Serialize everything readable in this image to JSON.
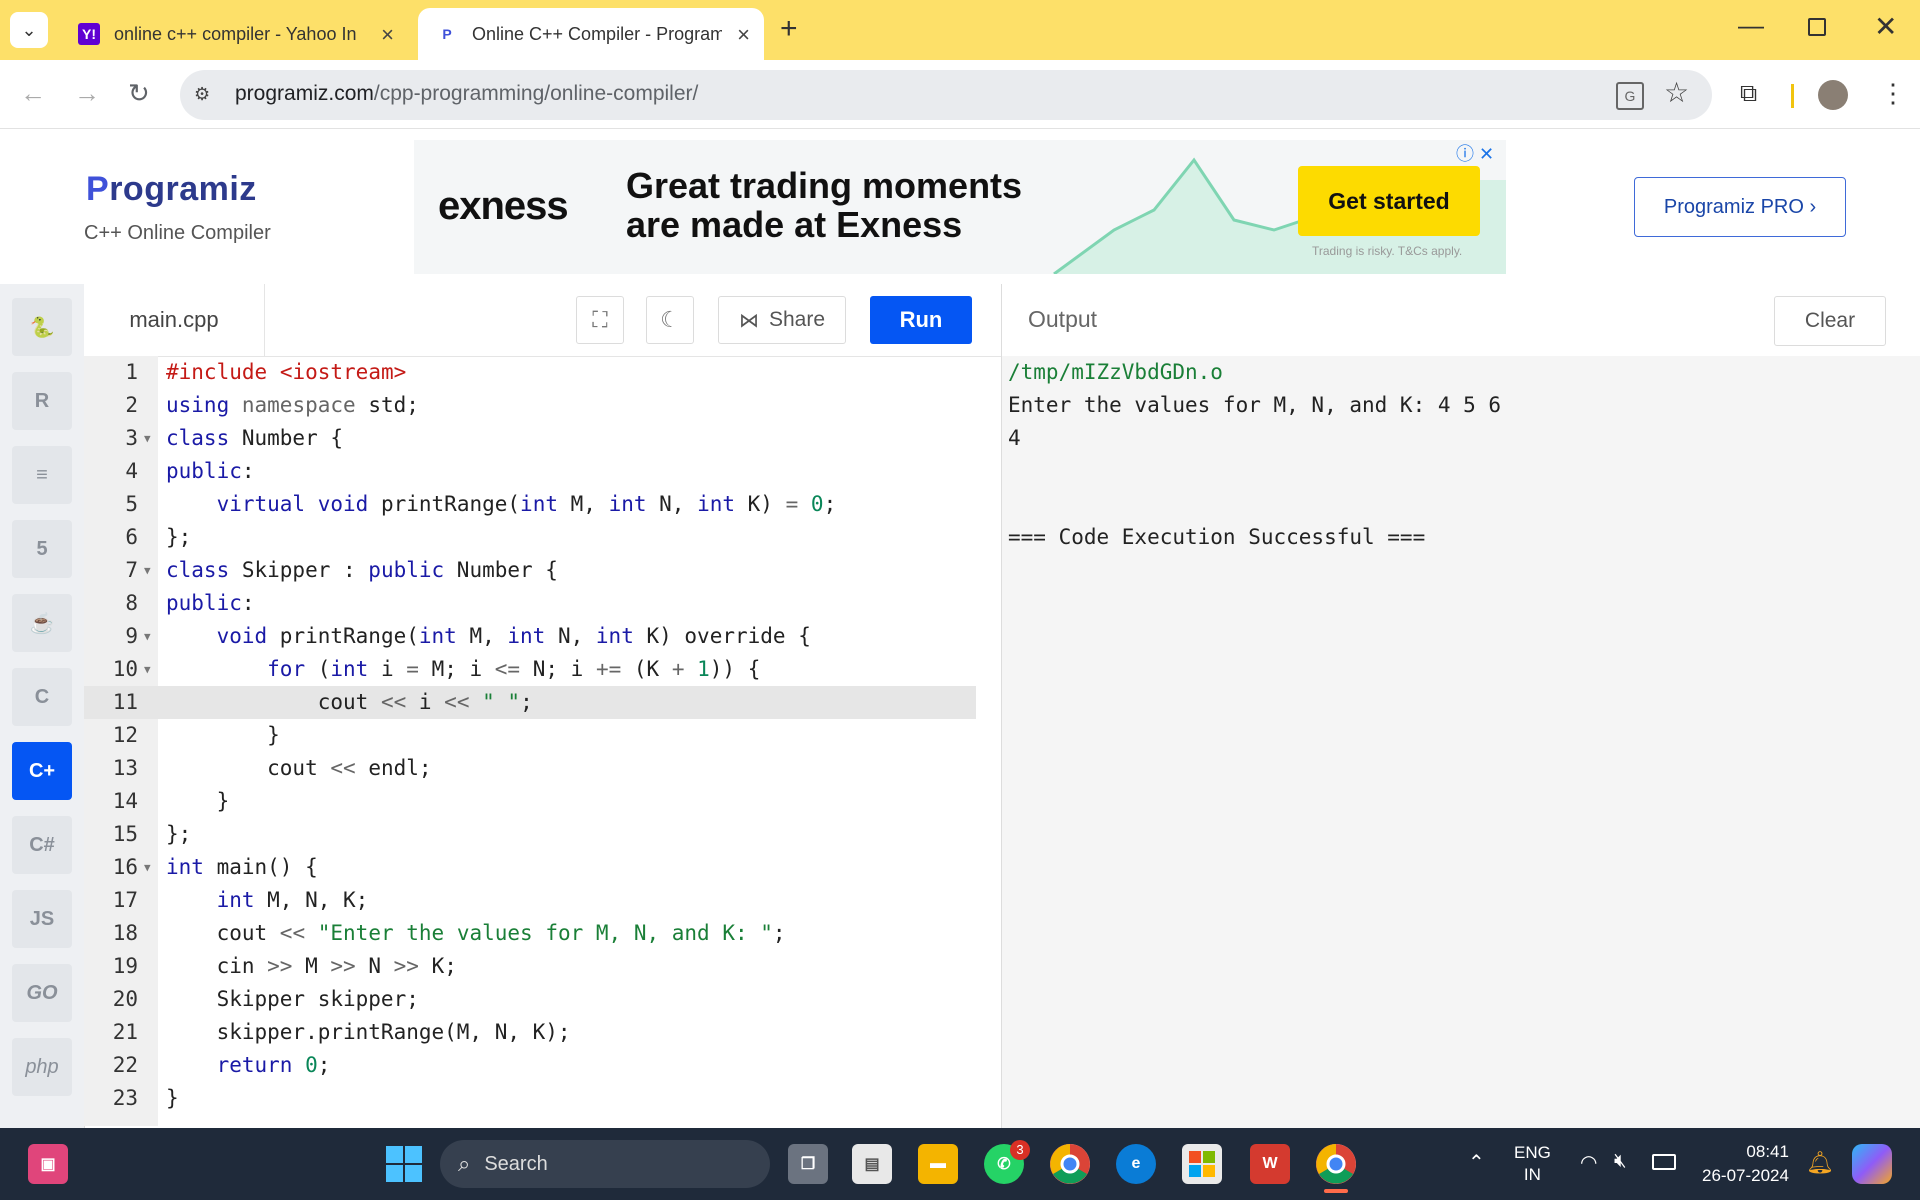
{
  "browser": {
    "tabs": [
      {
        "title": "online c++ compiler - Yahoo In",
        "favicon": "Y!"
      },
      {
        "title": "Online C++ Compiler - Program",
        "favicon": "P"
      }
    ],
    "url_host": "programiz.com",
    "url_path": "/cpp-programming/online-compiler/"
  },
  "site": {
    "logo_p": "P",
    "logo_rest": "rogramiz",
    "subtitle": "C++ Online Compiler",
    "pro_button": "Programiz PRO ›"
  },
  "ad": {
    "brand": "exness",
    "headline_1": "Great trading moments",
    "headline_2": "are made at Exness",
    "cta": "Get started",
    "fine_print": "Trading is risky. T&Cs apply."
  },
  "languages": [
    {
      "name": "python",
      "glyph": "🐍"
    },
    {
      "name": "r",
      "glyph": "R"
    },
    {
      "name": "sql",
      "glyph": "≡"
    },
    {
      "name": "html",
      "glyph": "5"
    },
    {
      "name": "java",
      "glyph": "☕"
    },
    {
      "name": "c",
      "glyph": "C"
    },
    {
      "name": "cpp",
      "glyph": "C+"
    },
    {
      "name": "csharp",
      "glyph": "C#"
    },
    {
      "name": "js",
      "glyph": "JS"
    },
    {
      "name": "go",
      "glyph": "GO"
    },
    {
      "name": "php",
      "glyph": "php"
    }
  ],
  "editor": {
    "filename": "main.cpp",
    "share_label": "Share",
    "run_label": "Run",
    "active_line": 11
  },
  "output": {
    "title": "Output",
    "clear_label": "Clear",
    "lines": [
      "/tmp/mIZzVbdGDn.o",
      "Enter the values for M, N, and K: 4 5 6",
      "4",
      "",
      "",
      "=== Code Execution Successful ==="
    ]
  },
  "taskbar": {
    "search_placeholder": "Search",
    "lang_1": "ENG",
    "lang_2": "IN",
    "time": "08:41",
    "date": "26-07-2024",
    "whatsapp_badge": "3"
  }
}
